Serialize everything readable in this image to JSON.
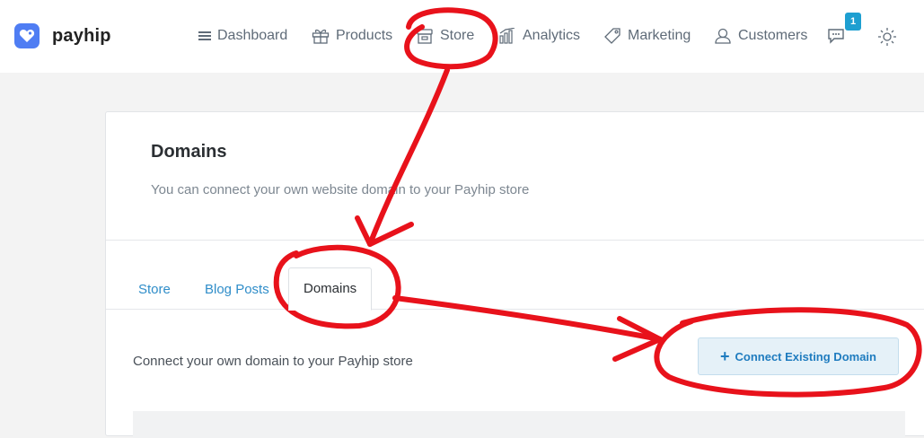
{
  "brand": {
    "name": "payhip",
    "color": "#4f7df3"
  },
  "nav": {
    "items": [
      {
        "id": "dashboard",
        "label": "Dashboard",
        "icon": "menu-icon"
      },
      {
        "id": "products",
        "label": "Products",
        "icon": "gift-icon"
      },
      {
        "id": "store",
        "label": "Store",
        "icon": "store-icon"
      },
      {
        "id": "analytics",
        "label": "Analytics",
        "icon": "analytics-icon"
      },
      {
        "id": "marketing",
        "label": "Marketing",
        "icon": "tag-icon"
      },
      {
        "id": "customers",
        "label": "Customers",
        "icon": "user-icon"
      }
    ],
    "notification_count": "1"
  },
  "page": {
    "title": "Domains",
    "subtitle": "You can connect your own website domain to your Payhip store"
  },
  "tabs": [
    {
      "label": "Store",
      "active": false
    },
    {
      "label": "Blog Posts",
      "active": false
    },
    {
      "label": "Domains",
      "active": true
    }
  ],
  "domains": {
    "description": "Connect your own domain to your Payhip store",
    "connect_button": "Connect Existing Domain"
  },
  "colors": {
    "annotation": "#e8121b",
    "link": "#2f8dc9"
  }
}
